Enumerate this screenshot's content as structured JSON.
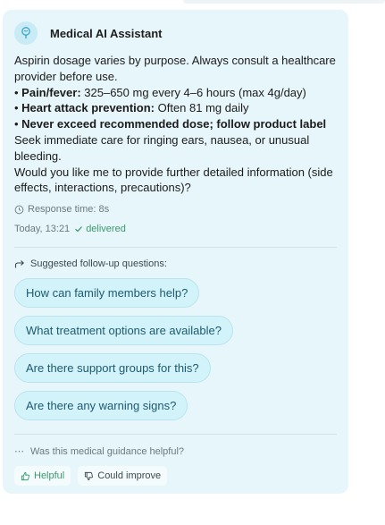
{
  "assistant": {
    "name": "Medical AI Assistant",
    "avatar_icon": "stethoscope-icon"
  },
  "message": {
    "intro": "Aspirin dosage varies by purpose. Always consult a healthcare provider before use.",
    "bullets": [
      {
        "prefix": "• ",
        "label": "Pain/fever:",
        "text": " 325–650 mg every 4–6 hours (max 4g/day)"
      },
      {
        "prefix": "• ",
        "label": "Heart attack prevention:",
        "text": " Often 81 mg daily"
      },
      {
        "prefix": "• ",
        "label": "Never exceed recommended dose; follow product label",
        "text": ""
      }
    ],
    "warning": "Seek immediate care for ringing ears, nausea, or unusual bleeding.",
    "question": "Would you like me to provide further detailed information (side effects, interactions, precautions)?",
    "response_time": "Response time: 8s",
    "timestamp": "Today, 13:21",
    "status": "delivered"
  },
  "suggestions": {
    "heading": "Suggested follow-up questions:",
    "items": [
      "How can family members help?",
      "What treatment options are available?",
      "Are there support groups for this?",
      "Are there any warning signs?"
    ]
  },
  "feedback": {
    "question": "Was this medical guidance helpful?",
    "helpful_label": "Helpful",
    "improve_label": "Could improve"
  },
  "colors": {
    "card_bg": "#e7f6fb",
    "chip_bg": "#d3f3fb",
    "accent_green": "#3a9a6c",
    "chip_text": "#1d5a6e"
  }
}
